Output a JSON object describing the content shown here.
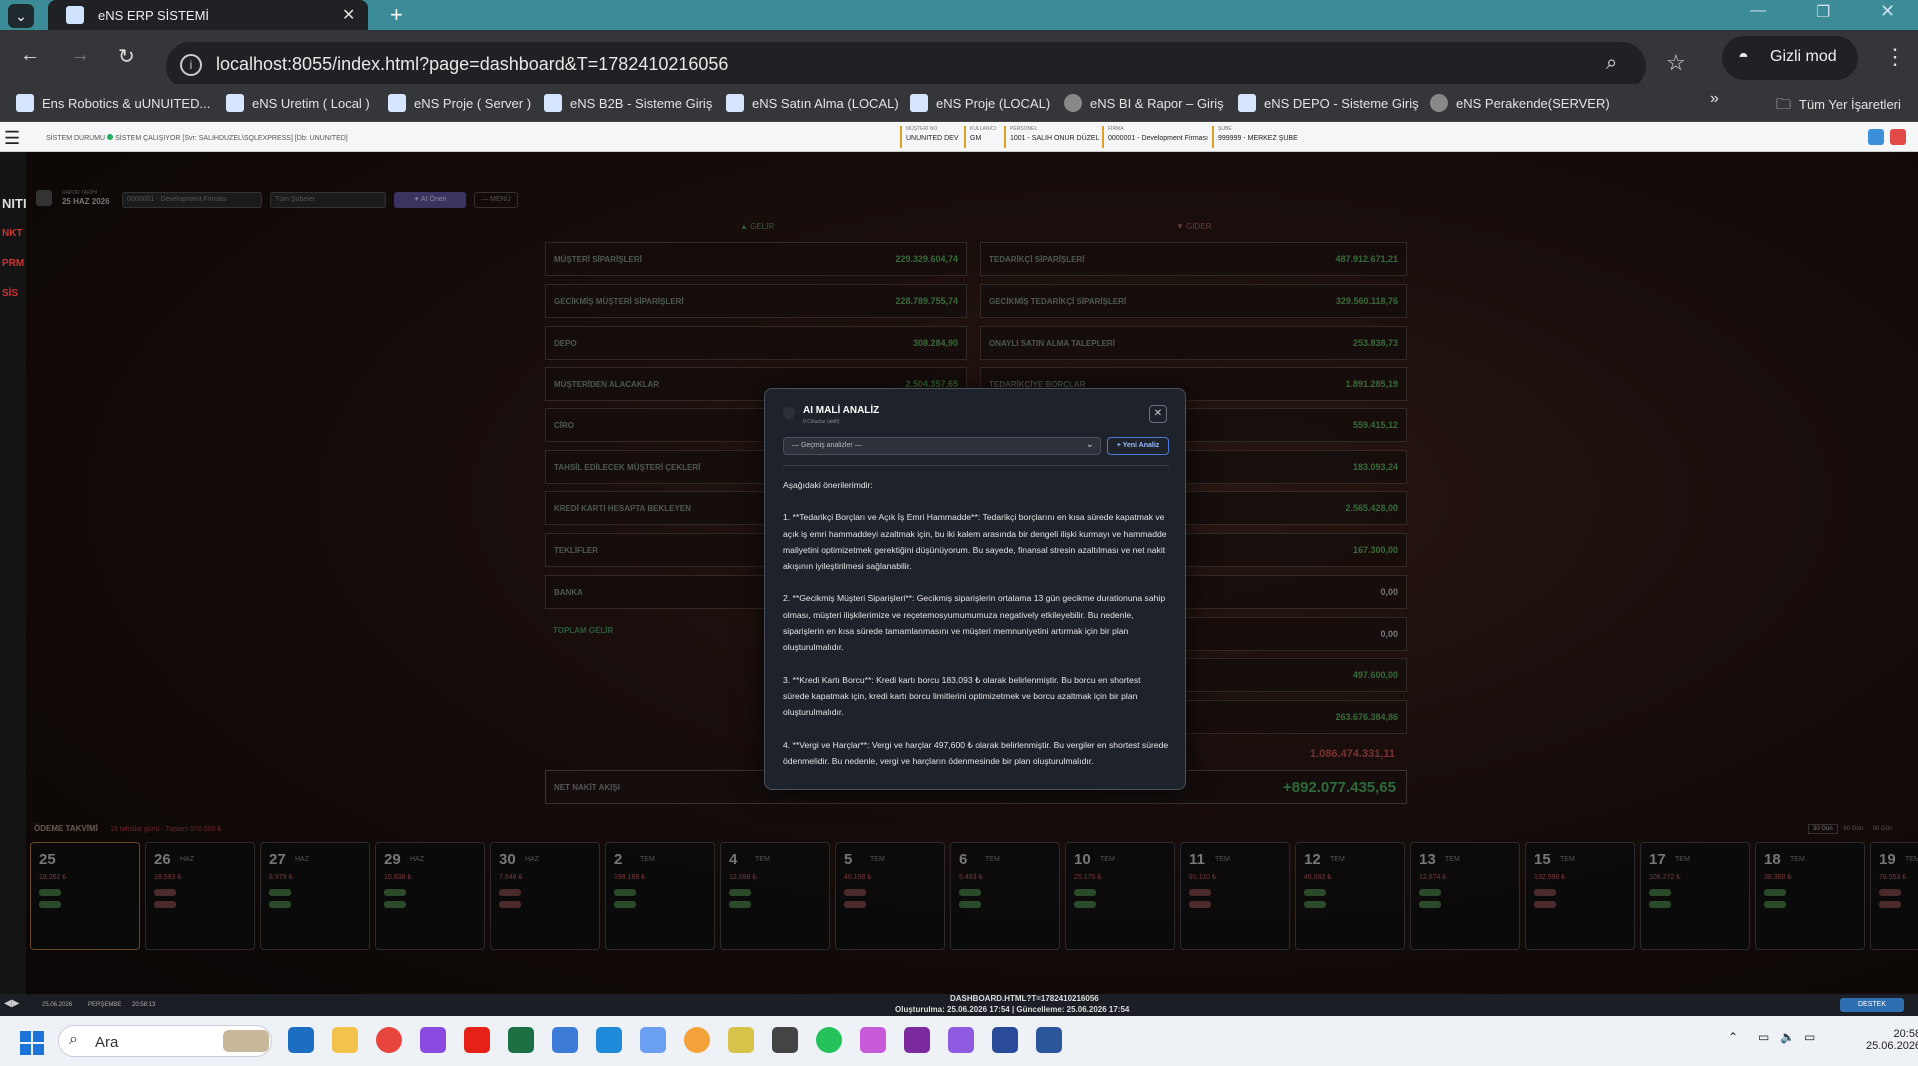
{
  "browser": {
    "tab_title": "eNS ERP SİSTEMİ",
    "url": "localhost:8055/index.html?page=dashboard&T=1782410216056",
    "incognito_label": "Gizli mod",
    "bookmarks": [
      "Ens Robotics & uUNUITED...",
      "eNS Uretim ( Local )",
      "eNS Proje ( Server )",
      "eNS B2B - Sisteme Giriş",
      "eNS Satın Alma (LOCAL)",
      "eNS Proje (LOCAL)",
      "eNS BI & Rapor – Giriş",
      "eNS DEPO - Sisteme Giriş",
      "eNS Perakende(SERVER)"
    ],
    "all_bookmarks": "Tüm Yer İşaretleri"
  },
  "header": {
    "system_status_key": "SİSTEM DURUMU",
    "system_status": "SİSTEM ÇALIŞIYOR [Svr: SALIHDUZEL\\SQLEXPRESS] [Db: UNUNITED]",
    "cells": [
      {
        "k": "MÜŞTERİ NO",
        "v": "UNUNITED DEV"
      },
      {
        "k": "KULLANICI",
        "v": "GM"
      },
      {
        "k": "PERSONEL",
        "v": "1001 - SALIH ONUR DÜZEL"
      },
      {
        "k": "FİRMA",
        "v": "0000001 - Development Firması"
      },
      {
        "k": "ŞUBE",
        "v": "999999 - MERKEZ ŞUBE"
      }
    ]
  },
  "rail": [
    "NITI",
    "NKT",
    "PRM",
    "SİS"
  ],
  "filters": {
    "date_label": "RAPOR TARİHİ",
    "date": "25 HAZ 2026",
    "company": "0000001 - Development Firması",
    "branch": "Tüm Şubeler",
    "ai_button": "✦ AI Öneri",
    "menu_button": "— MENÜ"
  },
  "dashboard": {
    "income_header": "▲ GELİR",
    "expense_header": "▼ GİDER",
    "left_rows": [
      {
        "label": "MÜŞTERİ SİPARİŞLERİ",
        "value": "229.329.604,74"
      },
      {
        "label": "GECİKMİŞ MÜŞTERİ SİPARİŞLERİ",
        "value": "228.789.755,74"
      },
      {
        "label": "DEPO",
        "value": "308.284,90"
      },
      {
        "label": "MÜŞTERİDEN ALACAKLAR",
        "value": "2.504.357,65"
      },
      {
        "label": "CİRO",
        "value": ""
      },
      {
        "label": "TAHSİL EDİLECEK MÜŞTERİ ÇEKLERİ",
        "value": ""
      },
      {
        "label": "KREDİ KARTI HESAPTA BEKLEYEN",
        "value": ""
      },
      {
        "label": "TEKLİFLER",
        "value": ""
      },
      {
        "label": "BANKA",
        "value": ""
      }
    ],
    "right_rows": [
      {
        "label": "TEDARİKÇİ SİPARİŞLERİ",
        "value": "487.912.671,21"
      },
      {
        "label": "GECİKMİŞ TEDARİKÇİ SİPARİŞLERİ",
        "value": "329.560.118,76"
      },
      {
        "label": "ONAYLI SATIN ALMA TALEPLERİ",
        "value": "253.838,73"
      },
      {
        "label": "TEDARİKÇİYE BORÇLAR",
        "value": "1.891.285,19"
      },
      {
        "label": "",
        "value": "559.415,12"
      },
      {
        "label": "",
        "value": "183.093,24"
      },
      {
        "label": "",
        "value": "2.565.428,00"
      },
      {
        "label": "",
        "value": "167.300,00"
      },
      {
        "label": "",
        "value": "0,00"
      },
      {
        "label": "",
        "value": "0,00"
      },
      {
        "label": "",
        "value": "497.600,00"
      },
      {
        "label": "",
        "value": "263.676.384,86"
      }
    ],
    "total_income_label": "TOPLAM GELİR",
    "total_expense": "1.086.474.331,11",
    "net_label": "NET NAKİT AKIŞI",
    "net_value": "+892.077.435,65"
  },
  "calendar": {
    "title": "ÖDEME TAKVİMİ",
    "subtitle": "19 tahsilat günü · Toplam 970.000 ₺",
    "views": [
      "30 Gün",
      "60 Gün",
      "90 Gün"
    ],
    "days": [
      {
        "day": "25",
        "mon": "",
        "amt": "18.262 ₺"
      },
      {
        "day": "26",
        "mon": "HAZ",
        "amt": "18.593 ₺"
      },
      {
        "day": "27",
        "mon": "HAZ",
        "amt": "8.979 ₺"
      },
      {
        "day": "29",
        "mon": "HAZ",
        "amt": "10.838 ₺"
      },
      {
        "day": "30",
        "mon": "HAZ",
        "amt": "7.648 ₺"
      },
      {
        "day": "2",
        "mon": "TEM",
        "amt": "198.169 ₺"
      },
      {
        "day": "4",
        "mon": "TEM",
        "amt": "12.098 ₺"
      },
      {
        "day": "5",
        "mon": "TEM",
        "amt": "46.158 ₺"
      },
      {
        "day": "6",
        "mon": "TEM",
        "amt": "5.483 ₺"
      },
      {
        "day": "10",
        "mon": "TEM",
        "amt": "25.175 ₺"
      },
      {
        "day": "11",
        "mon": "TEM",
        "amt": "91.110 ₺"
      },
      {
        "day": "12",
        "mon": "TEM",
        "amt": "46.092 ₺"
      },
      {
        "day": "13",
        "mon": "TEM",
        "amt": "12.874 ₺"
      },
      {
        "day": "15",
        "mon": "TEM",
        "amt": "132.998 ₺"
      },
      {
        "day": "17",
        "mon": "TEM",
        "amt": "108.272 ₺"
      },
      {
        "day": "18",
        "mon": "TEM",
        "amt": "38.360 ₺"
      },
      {
        "day": "19",
        "mon": "TEM",
        "amt": "78.553 ₺"
      }
    ]
  },
  "statusbar": {
    "date": "25.06.2026",
    "weekday": "PERŞEMBE",
    "time": "20:58:13",
    "file": "DASHBOARD.HTML?T=1782410216056",
    "dates": "Oluşturulma: 25.06.2026 17:54 | Güncelleme: 25.06.2026 17:54",
    "support": "DESTEK"
  },
  "modal": {
    "title": "AI MALİ ANALİZ",
    "subtitle": "0 Cihazlar (aktif)",
    "select_placeholder": "— Geçmiş analizler —",
    "new_button": "+ Yeni Analiz",
    "paragraphs": [
      "Aşağıdaki önerilerimdir:",
      "1. **Tedarikçi Borçları ve Açık İş Emri Hammadde**: Tedarikçi borçlarını en kısa sürede kapatmak ve açık iş emri hammaddeyi azaltmak için, bu iki kalem arasında bir dengeli ilişki kurmayı ve hammadde maliyetini optimizetmek gerektiğini düşünüyorum. Bu sayede, finansal stresin azaltılması ve net nakit akışının iyileştirilmesi sağlanabilir.",
      "2. **Gecikmiş Müşteri Siparişleri**: Gecikmiş siparişlerin ortalama 13 gün gecikme durationuna sahip olması, müşteri ilişkilerimize ve reçetemosyumumumuza negatively etkileyebilir. Bu nedenle, siparişlerin en kısa sürede tamamlanmasını ve müşteri memnuniyetini artırmak için bir plan oluşturulmalıdır.",
      "3. **Kredi Kartı Borcu**: Kredi kartı borcu 183,093 ₺ olarak belirlenmiştir. Bu borcu en shortest sürede kapatmak için, kredi kartı borcu limitlerini optimizetmek ve borcu azaltmak için bir plan oluşturulmalıdır.",
      "4. **Vergi ve Harçlar**: Vergi ve harçlar 497,600 ₺ olarak belirlenmiştir. Bu vergiler en shortest sürede ödenmelidir. Bu nedenle, vergi ve harçların ödenmesinde bir plan oluşturulmalıdır."
    ]
  },
  "taskbar": {
    "search": "Ara",
    "time": "20:58",
    "date": "25.06.2026"
  },
  "colors": {
    "tabbar": "#3b8c98",
    "accent_blue": "#4a7ad8",
    "status_green": "#27ae60"
  }
}
